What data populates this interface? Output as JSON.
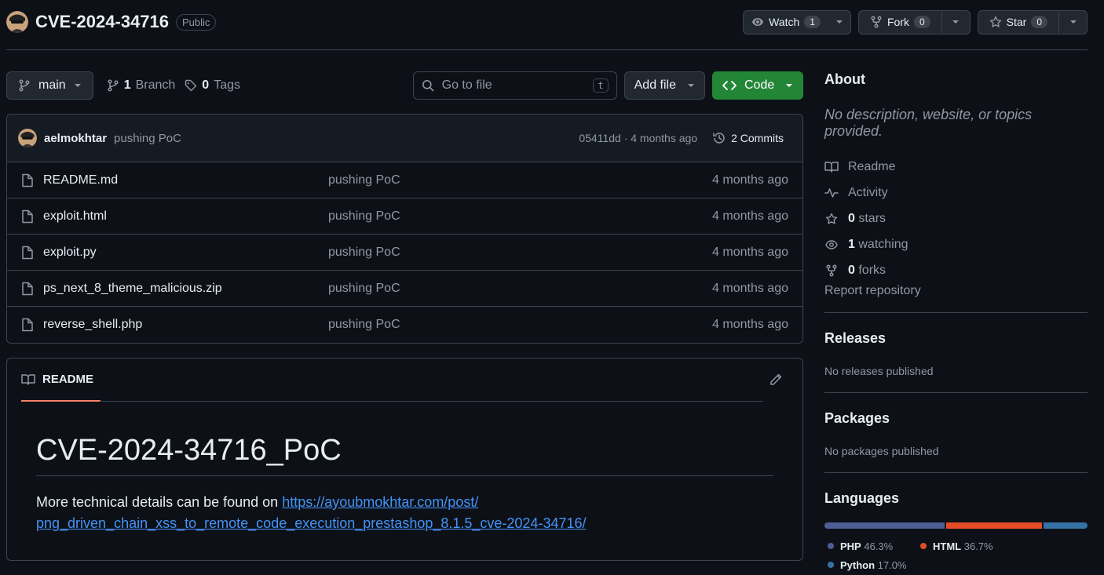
{
  "header": {
    "repo_name": "CVE-2024-34716",
    "visibility": "Public",
    "watch": {
      "label": "Watch",
      "count": "1"
    },
    "fork": {
      "label": "Fork",
      "count": "0"
    },
    "star": {
      "label": "Star",
      "count": "0"
    }
  },
  "toolbar": {
    "branch": "main",
    "branches_count": "1",
    "branches_label": "Branch",
    "tags_count": "0",
    "tags_label": "Tags",
    "search_placeholder": "Go to file",
    "search_shortcut": "t",
    "add_file": "Add file",
    "code": "Code"
  },
  "latest_commit": {
    "author": "aelmokhtar",
    "message": "pushing PoC",
    "hash_time": "05411dd · 4 months ago",
    "commits_label": "2 Commits"
  },
  "files": [
    {
      "name": "README.md",
      "message": "pushing PoC",
      "date": "4 months ago"
    },
    {
      "name": "exploit.html",
      "message": "pushing PoC",
      "date": "4 months ago"
    },
    {
      "name": "exploit.py",
      "message": "pushing PoC",
      "date": "4 months ago"
    },
    {
      "name": "ps_next_8_theme_malicious.zip",
      "message": "pushing PoC",
      "date": "4 months ago"
    },
    {
      "name": "reverse_shell.php",
      "message": "pushing PoC",
      "date": "4 months ago"
    }
  ],
  "readme": {
    "tab_label": "README",
    "title": "CVE-2024-34716_PoC",
    "text": "More technical details can be found on ",
    "link_line1": "https://ayoubmokhtar.com/post/",
    "link_line2": "png_driven_chain_xss_to_remote_code_execution_prestashop_8.1.5_cve-2024-34716/"
  },
  "about": {
    "heading": "About",
    "description": "No description, website, or topics provided.",
    "readme": "Readme",
    "activity": "Activity",
    "stars_count": "0",
    "stars_label": "stars",
    "watching_count": "1",
    "watching_label": "watching",
    "forks_count": "0",
    "forks_label": "forks",
    "report": "Report repository"
  },
  "releases": {
    "heading": "Releases",
    "text": "No releases published"
  },
  "packages": {
    "heading": "Packages",
    "text": "No packages published"
  },
  "languages": {
    "heading": "Languages",
    "items": [
      {
        "name": "PHP",
        "percent": "46.3%",
        "value": 46.3,
        "color": "#4F5D95"
      },
      {
        "name": "HTML",
        "percent": "36.7%",
        "value": 36.7,
        "color": "#e34c26"
      },
      {
        "name": "Python",
        "percent": "17.0%",
        "value": 17.0,
        "color": "#3572A5"
      }
    ]
  }
}
